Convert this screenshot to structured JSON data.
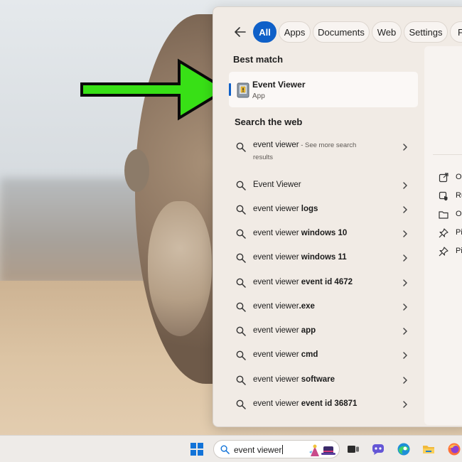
{
  "filters": {
    "items": [
      {
        "label": "All",
        "active": true
      },
      {
        "label": "Apps"
      },
      {
        "label": "Documents"
      },
      {
        "label": "Web"
      },
      {
        "label": "Settings"
      },
      {
        "label": "Fo"
      }
    ]
  },
  "best_match": {
    "title": "Best match",
    "app_name": "Event Viewer",
    "app_type": "App"
  },
  "web": {
    "title": "Search the web",
    "results": [
      {
        "prefix": "event viewer",
        "bold": "",
        "hint": " - See more search",
        "sub": "results"
      },
      {
        "prefix": "Event Viewer",
        "bold": ""
      },
      {
        "prefix": "event viewer ",
        "bold": "logs"
      },
      {
        "prefix": "event viewer ",
        "bold": "windows 10"
      },
      {
        "prefix": "event viewer ",
        "bold": "windows 11"
      },
      {
        "prefix": "event viewer ",
        "bold": "event id 4672"
      },
      {
        "prefix": "event viewer",
        "bold": ".exe"
      },
      {
        "prefix": "event viewer ",
        "bold": "app"
      },
      {
        "prefix": "event viewer ",
        "bold": "cmd"
      },
      {
        "prefix": "event viewer ",
        "bold": "software"
      },
      {
        "prefix": "event viewer ",
        "bold": "event id 36871"
      }
    ]
  },
  "details": {
    "actions": [
      {
        "label": "Op",
        "icon": "open-icon"
      },
      {
        "label": "Ru",
        "icon": "run-as-admin-icon"
      },
      {
        "label": "Op",
        "icon": "folder-icon"
      },
      {
        "label": "Pi",
        "icon": "pin-icon"
      },
      {
        "label": "Pi",
        "icon": "pin-icon"
      }
    ]
  },
  "taskbar": {
    "search_value": "event viewer",
    "apps": [
      "task-view-icon",
      "chat-icon",
      "edge-icon",
      "file-explorer-icon",
      "firefox-icon"
    ]
  },
  "colors": {
    "accent": "#0f60c8",
    "arrow": "#38e016"
  }
}
